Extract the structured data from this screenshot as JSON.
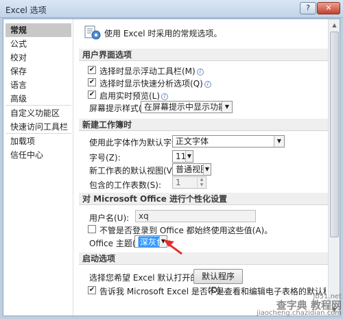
{
  "window": {
    "title": "Excel 选项",
    "help_glyph": "?",
    "close_glyph": "✕"
  },
  "sidebar": {
    "items": [
      {
        "label": "常规"
      },
      {
        "label": "公式"
      },
      {
        "label": "校对"
      },
      {
        "label": "保存"
      },
      {
        "label": "语言"
      },
      {
        "label": "高级"
      },
      {
        "label": "自定义功能区"
      },
      {
        "label": "快速访问工具栏"
      },
      {
        "label": "加载项"
      },
      {
        "label": "信任中心"
      }
    ],
    "active": "常规"
  },
  "header": {
    "text": "使用 Excel 时采用的常规选项。"
  },
  "ui_options": {
    "title": "用户界面选项",
    "mini_toolbar": {
      "label": "选择时显示浮动工具栏(M)",
      "checked": true
    },
    "quick_analysis": {
      "label": "选择时显示快速分析选项(Q)",
      "checked": true
    },
    "live_preview": {
      "label": "启用实时预览(L)",
      "checked": true
    },
    "screentip": {
      "label": "屏幕提示样式(R):",
      "value": "在屏幕提示中显示功能说明"
    }
  },
  "new_workbook": {
    "title": "新建工作簿时",
    "font": {
      "label": "使用此字体作为默认字体(N):",
      "value": "正文字体"
    },
    "size": {
      "label": "字号(Z):",
      "value": "11"
    },
    "view": {
      "label": "新工作表的默认视图(V):",
      "value": "普通视图"
    },
    "sheets": {
      "label": "包含的工作表数(S):",
      "value": "1"
    }
  },
  "personalize": {
    "title": "对 Microsoft Office 进行个性化设置",
    "username": {
      "label": "用户名(U):",
      "value": "xq"
    },
    "always_use": {
      "label": "不管是否登录到 Office 都始终使用这些值(A)。",
      "checked": false
    },
    "theme": {
      "label": "Office 主题(T):",
      "value": "深灰色"
    }
  },
  "startup": {
    "title": "启动选项",
    "extensions": {
      "label": "选择您希望 Excel 默认打开的扩展名:",
      "button": "默认程序(D)..."
    },
    "tell_me": {
      "label": "告诉我 Microsoft Excel 是否不是查看和编辑电子表格的默认程",
      "checked": true
    }
  },
  "watermark": {
    "line1": "jb51.net",
    "line2": "查字典 教程网",
    "line3": "jiaocheng.chazidian.com"
  },
  "colors": {
    "accent_arrow": "#e0302c",
    "selection": "#3399ff"
  }
}
